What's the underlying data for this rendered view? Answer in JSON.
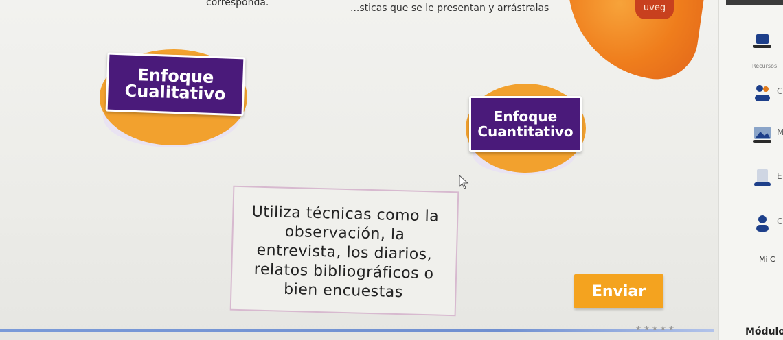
{
  "header": {
    "instruction_left": "corresponda.",
    "instruction_right": "...sticas que se le presentan y arrástralas",
    "brand_label": "uveg"
  },
  "cards": [
    {
      "line1": "Enfoque",
      "line2": "Cualitativo"
    },
    {
      "line1": "Enfoque",
      "line2": "Cuantitativo"
    }
  ],
  "drop_zone": {
    "lines": [
      "Utiliza técnicas como la",
      "observación, la",
      "entrevista, los diarios,",
      "relatos bibliográficos o",
      "bien encuestas"
    ]
  },
  "submit": {
    "label": "Enviar"
  },
  "sidebar": {
    "caption_top": "Recursos",
    "items": [
      {
        "icon": "laptop-icon",
        "letter": ""
      },
      {
        "icon": "people-icon",
        "letter": "C"
      },
      {
        "icon": "image-icon",
        "letter": "M"
      },
      {
        "icon": "document-icon",
        "letter": "E"
      },
      {
        "icon": "user-icon",
        "letter": "C"
      }
    ],
    "mi_label": "Mi C",
    "module_label": "Módulo"
  },
  "footer": {
    "stars": "★★★★★"
  },
  "colors": {
    "card": "#4a1a7a",
    "accent": "#f4a31f",
    "brand": "#ef7d1c"
  }
}
